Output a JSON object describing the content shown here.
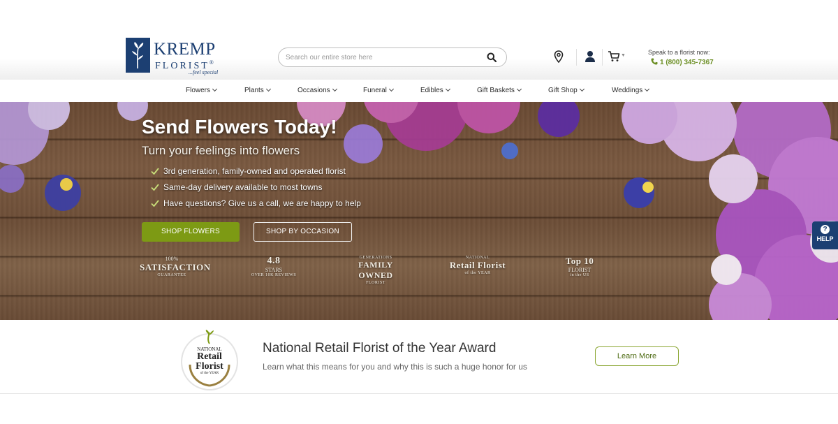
{
  "brand": {
    "name": "KREMP",
    "subname": "FLORIST",
    "registered": "®",
    "tagline": "...feel special"
  },
  "search": {
    "placeholder": "Search our entire store here"
  },
  "contact": {
    "label": "Speak to a florist now:",
    "phone": "1 (800) 345-7367"
  },
  "nav": {
    "items": [
      {
        "label": "Flowers"
      },
      {
        "label": "Plants"
      },
      {
        "label": "Occasions"
      },
      {
        "label": "Funeral"
      },
      {
        "label": "Edibles"
      },
      {
        "label": "Gift Baskets"
      },
      {
        "label": "Gift Shop"
      },
      {
        "label": "Weddings"
      }
    ]
  },
  "hero": {
    "title": "Send Flowers Today!",
    "subtitle": "Turn your feelings into flowers",
    "bullets": [
      "3rd generation, family-owned and operated florist",
      "Same-day delivery available to most towns",
      "Have questions? Give us a call, we are happy to help"
    ],
    "primary_button": "SHOP FLOWERS",
    "secondary_button": "SHOP BY OCCASION",
    "badges": [
      {
        "top": "100%",
        "main": "SATISFACTION",
        "bottom": "GUARANTEE"
      },
      {
        "top": "4.8",
        "main": "STARS",
        "bottom": "OVER 10K REVIEWS"
      },
      {
        "top": "GENERATIONS",
        "main": "FAMILY OWNED",
        "bottom": "FLORIST"
      },
      {
        "top": "NATIONAL",
        "main": "Retail Florist",
        "bottom": "of the YEAR"
      },
      {
        "top": "Top 10",
        "main": "FLORIST",
        "bottom": "in the US"
      }
    ]
  },
  "help": {
    "label": "HELP"
  },
  "award": {
    "seal_top": "NATIONAL",
    "seal_main_1": "Retail",
    "seal_main_2": "Florist",
    "seal_bottom": "of the YEAR",
    "title": "National Retail Florist of the Year Award",
    "description": "Learn what this means for you and why this is such a huge honor for us",
    "button": "Learn More"
  },
  "colors": {
    "brand_navy": "#1c3f72",
    "accent_green": "#7d9a14",
    "phone_green": "#6b8e23"
  }
}
